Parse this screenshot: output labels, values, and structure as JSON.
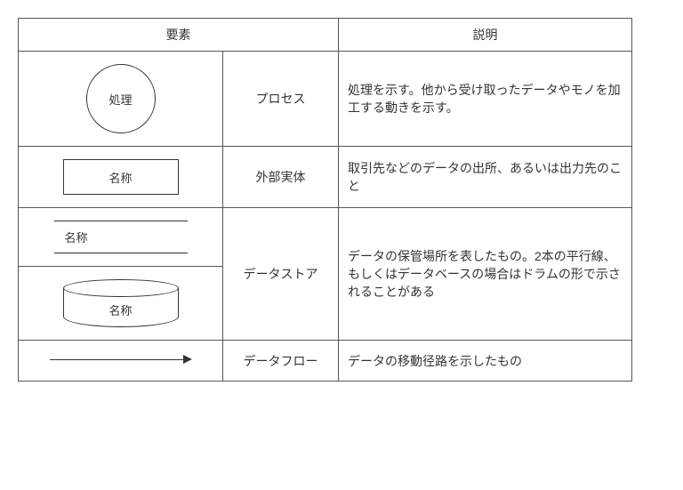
{
  "headers": {
    "element": "要素",
    "description": "説明"
  },
  "rows": {
    "process": {
      "symbol_label": "処理",
      "name": "プロセス",
      "desc": "処理を示す。他から受け取ったデータやモノを加工する動きを示す。"
    },
    "external": {
      "symbol_label": "名称",
      "name": "外部実体",
      "desc": "取引先などのデータの出所、あるいは出力先のこと"
    },
    "datastore": {
      "symbol_label_lines": "名称",
      "symbol_label_drum": "名称",
      "name": "データストア",
      "desc": "データの保管場所を表したもの。2本の平行線、もしくはデータベースの場合はドラムの形で示されることがある"
    },
    "dataflow": {
      "name": "データフロー",
      "desc": "データの移動径路を示したもの"
    }
  },
  "chart_data": {
    "type": "table",
    "title": "DFD notation elements",
    "columns": [
      "要素 (symbol)",
      "要素 (name)",
      "説明"
    ],
    "rows": [
      {
        "symbol": "circle labeled 処理",
        "name": "プロセス",
        "description": "処理を示す。他から受け取ったデータやモノを加工する動きを示す。"
      },
      {
        "symbol": "rectangle labeled 名称",
        "name": "外部実体",
        "description": "取引先などのデータの出所、あるいは出力先のこと"
      },
      {
        "symbol": "two parallel lines labeled 名称 / drum labeled 名称",
        "name": "データストア",
        "description": "データの保管場所を表したもの。2本の平行線、もしくはデータベースの場合はドラムの形で示されることがある"
      },
      {
        "symbol": "right-pointing arrow",
        "name": "データフロー",
        "description": "データの移動径路を示したもの"
      }
    ]
  }
}
